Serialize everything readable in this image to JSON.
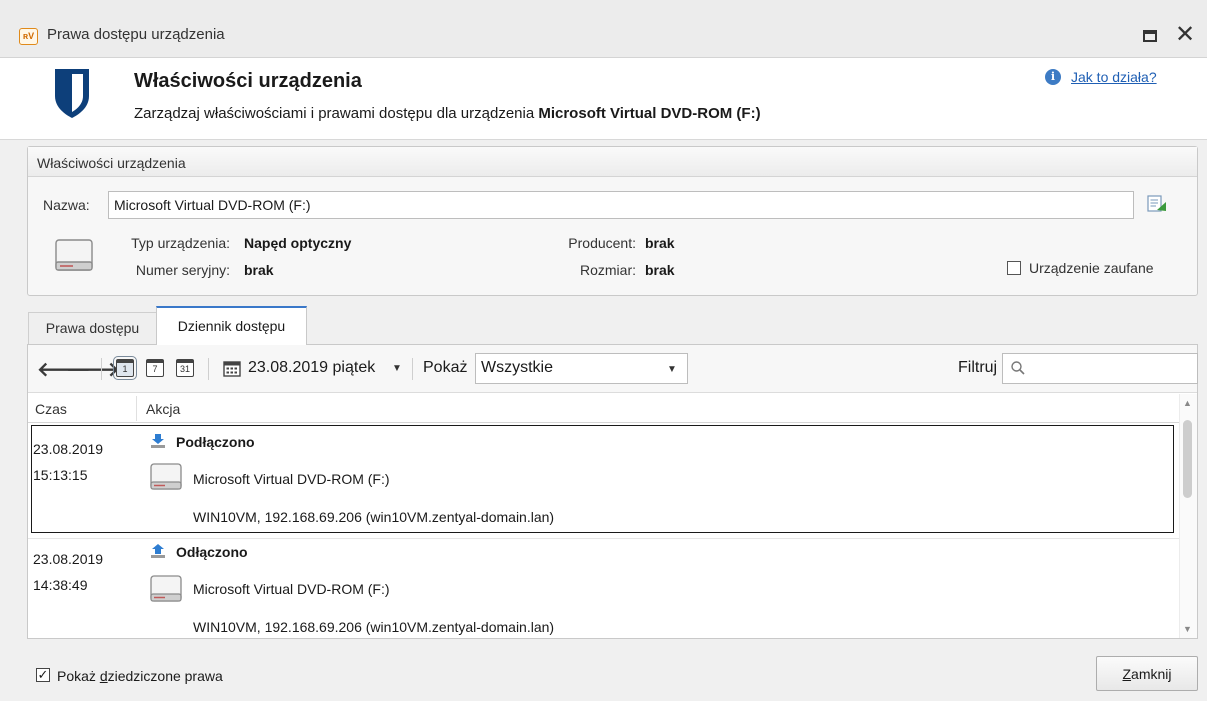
{
  "window": {
    "title": "Prawa dostępu urządzenia",
    "app_icon_text": "ʀV"
  },
  "header": {
    "title": "Właściwości urządzenia",
    "subtitle_prefix": "Zarządzaj właściwościami i prawami dostępu dla urządzenia ",
    "subtitle_device": "Microsoft Virtual DVD-ROM (F:)",
    "help_link": "Jak to działa?"
  },
  "properties": {
    "group_title": "Właściwości urządzenia",
    "name_label": "Nazwa:",
    "name_value": "Microsoft Virtual DVD-ROM (F:)",
    "type_label": "Typ urządzenia:",
    "type_value": "Napęd optyczny",
    "serial_label": "Numer seryjny:",
    "serial_value": "brak",
    "producer_label": "Producent:",
    "producer_value": "brak",
    "size_label": "Rozmiar:",
    "size_value": "brak",
    "trusted_label": "Urządzenie zaufane",
    "trusted_checked": false
  },
  "tabs": [
    {
      "label": "Prawa dostępu",
      "active": false
    },
    {
      "label": "Dziennik dostępu",
      "active": true
    }
  ],
  "toolbar": {
    "cal_week": "7",
    "cal_month": "31",
    "date": "23.08.2019 piątek",
    "show_label": "Pokaż",
    "show_value": "Wszystkie",
    "filter_label": "Filtruj",
    "filter_value": ""
  },
  "columns": {
    "time": "Czas",
    "action": "Akcja"
  },
  "rows": [
    {
      "date": "23.08.2019",
      "time": "15:13:15",
      "action": "Podłączono",
      "device": "Microsoft Virtual DVD-ROM (F:)",
      "host": "WIN10VM, 192.168.69.206 (win10VM.zentyal-domain.lan)"
    },
    {
      "date": "23.08.2019",
      "time": "14:38:49",
      "action": "Odłączono",
      "device": "Microsoft Virtual DVD-ROM (F:)",
      "host": "WIN10VM, 192.168.69.206 (win10VM.zentyal-domain.lan)"
    }
  ],
  "footer": {
    "inherit_prefix": "Pokaż ",
    "inherit_accel": "d",
    "inherit_suffix": "ziedziczone prawa",
    "inherit_checked": true,
    "close_accel": "Z",
    "close_rest": "amknij"
  },
  "colors": {
    "accent": "#3a78c9",
    "shield": "#0d3f7a",
    "link": "#1f5fb4"
  }
}
